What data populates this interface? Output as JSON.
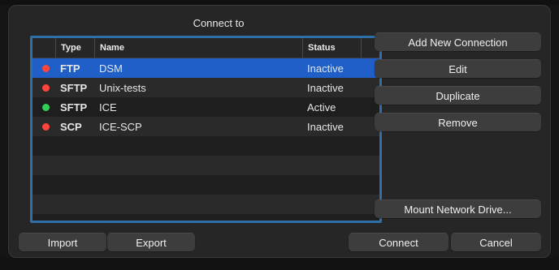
{
  "dialog": {
    "title": "Connect to"
  },
  "table": {
    "columns": [
      "Type",
      "Name",
      "Status"
    ],
    "rows": [
      {
        "type": "FTP",
        "name": "DSM",
        "status": "Inactive",
        "status_color": "#ff453a",
        "selected": true
      },
      {
        "type": "SFTP",
        "name": "Unix-tests",
        "status": "Inactive",
        "status_color": "#ff453a"
      },
      {
        "type": "SFTP",
        "name": "ICE",
        "status": "Active",
        "status_color": "#30d158"
      },
      {
        "type": "SCP",
        "name": "ICE-SCP",
        "status": "Inactive",
        "status_color": "#ff453a"
      }
    ],
    "empty_rows": 4
  },
  "side_buttons": {
    "add": "Add New Connection",
    "edit": "Edit",
    "duplicate": "Duplicate",
    "remove": "Remove",
    "mount": "Mount Network Drive..."
  },
  "bottom_buttons": {
    "import": "Import",
    "export": "Export",
    "connect": "Connect",
    "cancel": "Cancel"
  },
  "colors": {
    "selection": "#1f5fc7",
    "focus_ring": "#2f6ea6",
    "dialog_bg": "#262626"
  }
}
